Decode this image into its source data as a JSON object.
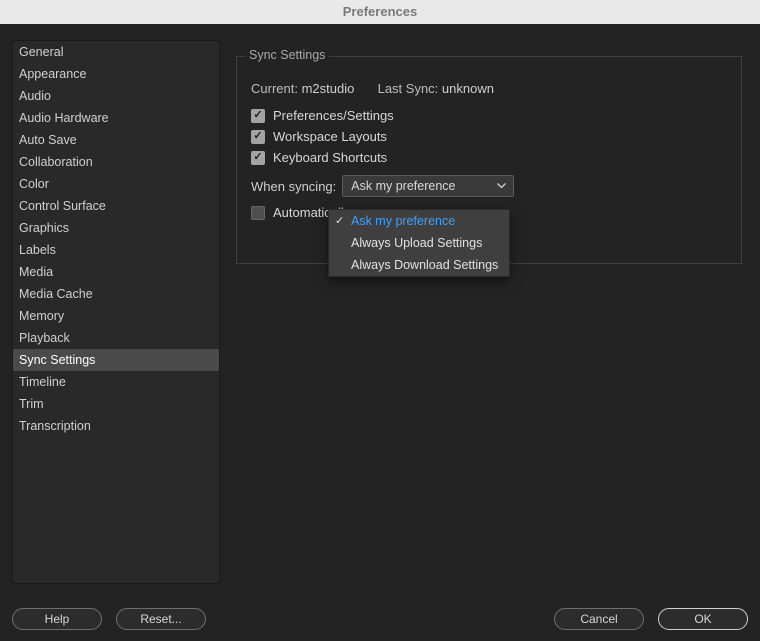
{
  "window": {
    "title": "Preferences"
  },
  "sidebar": {
    "items": [
      {
        "label": "General"
      },
      {
        "label": "Appearance"
      },
      {
        "label": "Audio"
      },
      {
        "label": "Audio Hardware"
      },
      {
        "label": "Auto Save"
      },
      {
        "label": "Collaboration"
      },
      {
        "label": "Color"
      },
      {
        "label": "Control Surface"
      },
      {
        "label": "Graphics"
      },
      {
        "label": "Labels"
      },
      {
        "label": "Media"
      },
      {
        "label": "Media Cache"
      },
      {
        "label": "Memory"
      },
      {
        "label": "Playback"
      },
      {
        "label": "Sync Settings"
      },
      {
        "label": "Timeline"
      },
      {
        "label": "Trim"
      },
      {
        "label": "Transcription"
      }
    ],
    "selected_index": 14
  },
  "panel": {
    "title": "Sync Settings",
    "info": {
      "current_label": "Current:",
      "current_value": "m2studio",
      "last_sync_label": "Last Sync:",
      "last_sync_value": "unknown"
    },
    "checks": [
      {
        "label": "Preferences/Settings",
        "checked": true
      },
      {
        "label": "Workspace Layouts",
        "checked": true
      },
      {
        "label": "Keyboard Shortcuts",
        "checked": true
      }
    ],
    "when_syncing_label": "When syncing:",
    "when_syncing_value": "Ask my preference",
    "auto_clear": {
      "label": "Automaticall",
      "checked": false
    }
  },
  "dropdown": {
    "options": [
      {
        "label": "Ask my preference",
        "selected": true
      },
      {
        "label": "Always Upload Settings",
        "selected": false
      },
      {
        "label": "Always Download Settings",
        "selected": false
      }
    ]
  },
  "footer": {
    "help": "Help",
    "reset": "Reset...",
    "cancel": "Cancel",
    "ok": "OK"
  }
}
